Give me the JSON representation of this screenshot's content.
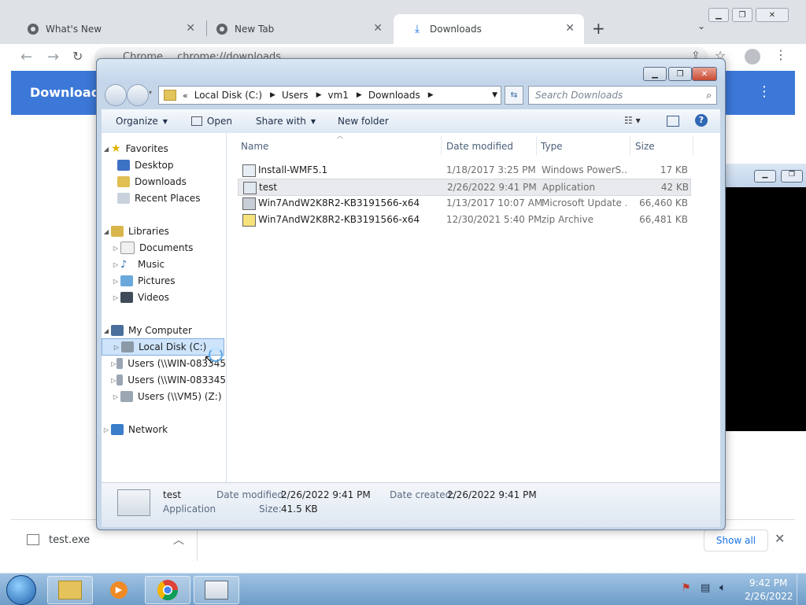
{
  "chrome": {
    "tabs": [
      {
        "title": "What's New",
        "icon": "chrome-icon"
      },
      {
        "title": "New Tab",
        "icon": "chrome-icon"
      },
      {
        "title": "Downloads",
        "icon": "download-icon"
      }
    ],
    "omnibox_label": "Chrome",
    "url": "chrome://downloads",
    "page_title": "Downloads",
    "shelf": {
      "file": "test.exe",
      "show_all": "Show all"
    }
  },
  "explorer": {
    "breadcrumb": [
      "Local Disk (C:)",
      "Users",
      "vm1",
      "Downloads"
    ],
    "search_placeholder": "Search Downloads",
    "commands": [
      "Organize",
      "Open",
      "Share with",
      "New folder"
    ],
    "nav": {
      "favorites_label": "Favorites",
      "favorites": [
        "Desktop",
        "Downloads",
        "Recent Places"
      ],
      "libraries_label": "Libraries",
      "libraries": [
        "Documents",
        "Music",
        "Pictures",
        "Videos"
      ],
      "computer_label": "My Computer",
      "computer": [
        "Local Disk (C:)",
        "Users (\\\\WIN-083345",
        "Users (\\\\WIN-083345",
        "Users (\\\\VM5) (Z:)"
      ],
      "network_label": "Network"
    },
    "columns": [
      "Name",
      "Date modified",
      "Type",
      "Size"
    ],
    "files": [
      {
        "name": "Install-WMF5.1",
        "date": "1/18/2017 3:25 PM",
        "type": "Windows PowerS...",
        "size": "17 KB"
      },
      {
        "name": "test",
        "date": "2/26/2022 9:41 PM",
        "type": "Application",
        "size": "42 KB"
      },
      {
        "name": "Win7AndW2K8R2-KB3191566-x64",
        "date": "1/13/2017 10:07 AM",
        "type": "Microsoft Update ...",
        "size": "66,460 KB"
      },
      {
        "name": "Win7AndW2K8R2-KB3191566-x64",
        "date": "12/30/2021 5:40 PM",
        "type": "zip Archive",
        "size": "66,481 KB"
      }
    ],
    "details": {
      "name": "test",
      "kind": "Application",
      "modified_label": "Date modified:",
      "modified": "2/26/2022 9:41 PM",
      "created_label": "Date created:",
      "created": "2/26/2022 9:41 PM",
      "size_label": "Size:",
      "size": "41.5 KB"
    }
  },
  "taskbar": {
    "time": "9:42 PM",
    "date": "2/26/2022"
  },
  "colors": {
    "chrome_header": "#3c78d8",
    "taskbar": "#7ea9d0"
  }
}
